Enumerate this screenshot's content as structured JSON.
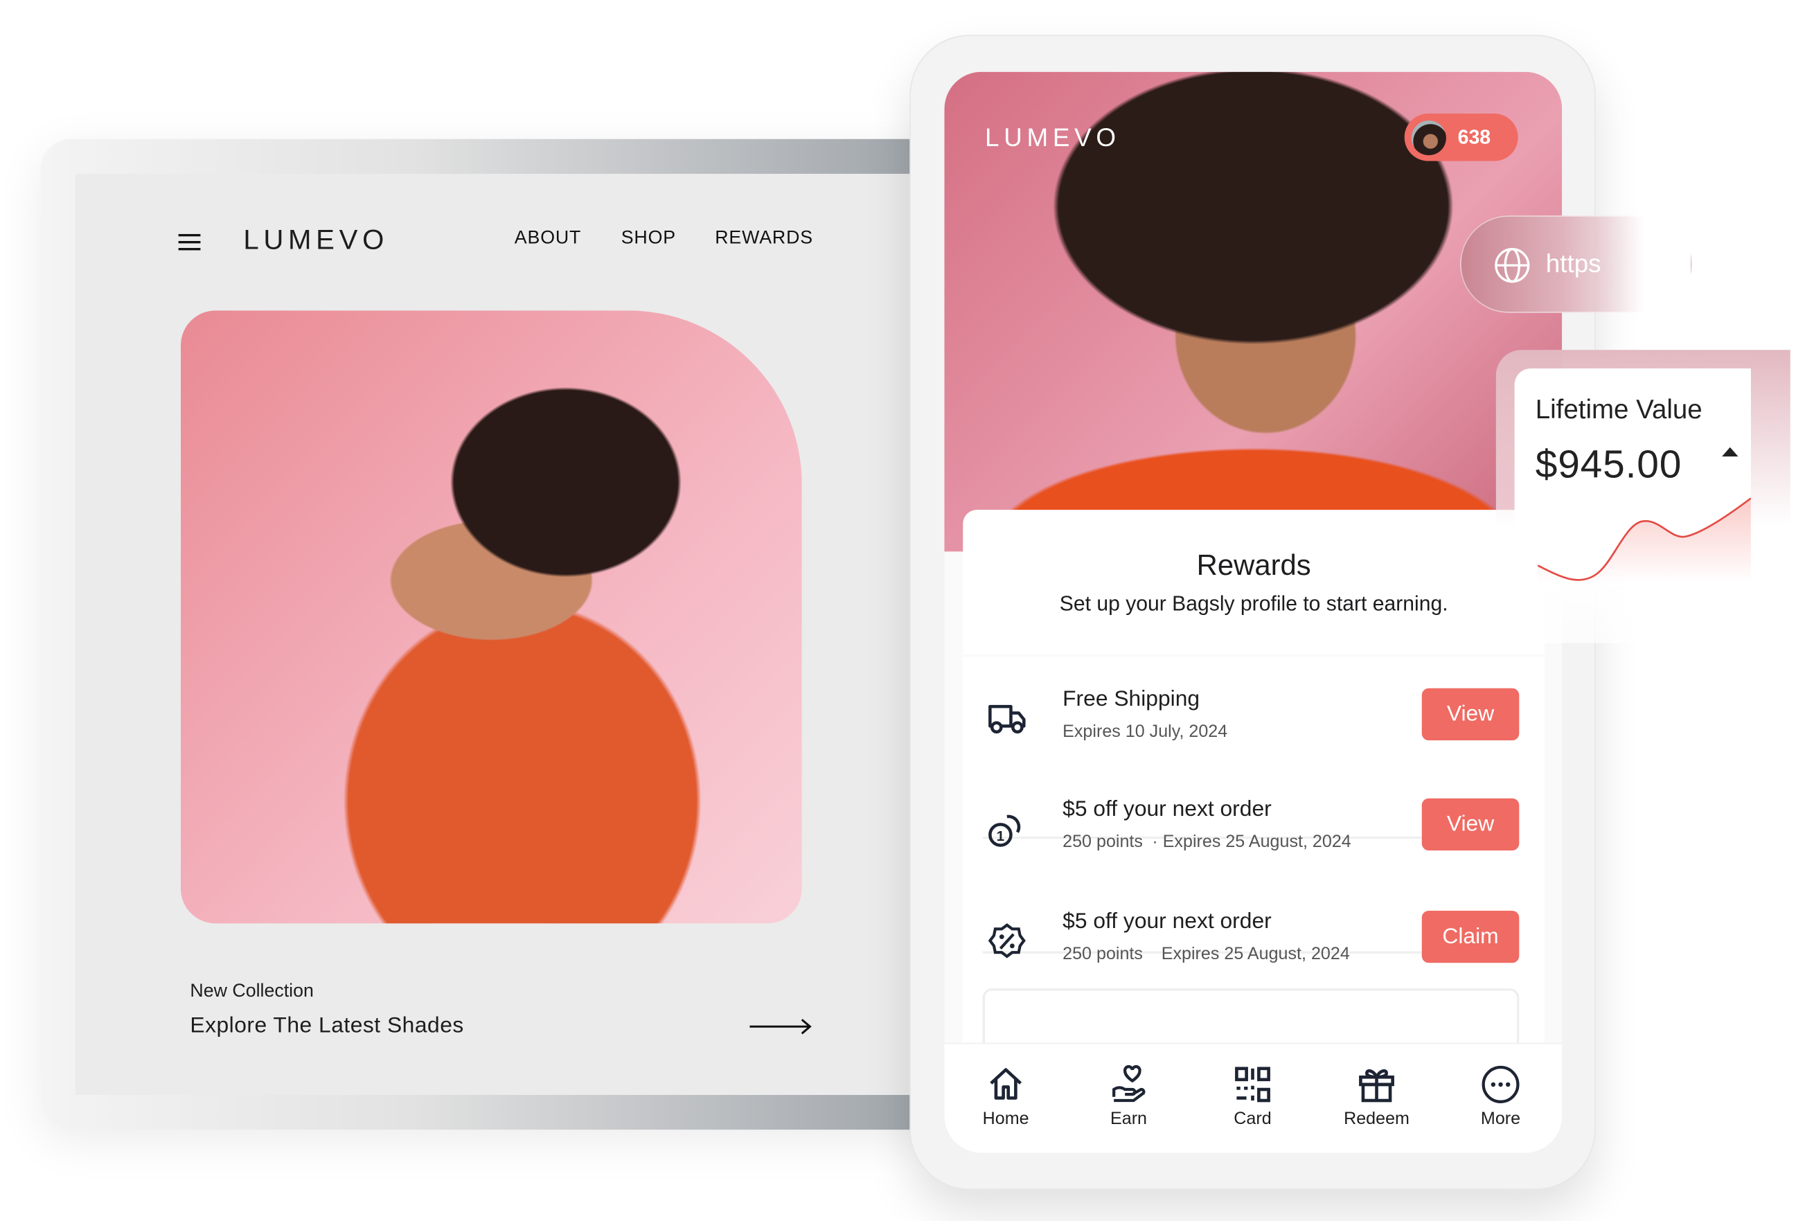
{
  "desktop": {
    "brand": "LUMEVO",
    "nav": [
      {
        "label": "ABOUT"
      },
      {
        "label": "SHOP"
      },
      {
        "label": "REWARDS"
      }
    ],
    "collection_label": "New Collection",
    "collection_title": "Explore The Latest Shades"
  },
  "mobile": {
    "brand": "LUMEVO",
    "points": "638",
    "rewards_title": "Rewards",
    "rewards_subtitle": "Set up your Bagsly profile to start earning.",
    "rewards": [
      {
        "icon": "truck-icon",
        "title": "Free Shipping",
        "points": "",
        "expires": "Expires 10 July, 2024",
        "action": "View"
      },
      {
        "icon": "coins-icon",
        "title": "$5 off your next order",
        "points": "250 points",
        "expires": "Expires 25 August, 2024",
        "action": "View"
      },
      {
        "icon": "discount-badge-icon",
        "title": "$5 off your next order",
        "points": "250 points",
        "expires": "Expires 25 August, 2024",
        "action": "Claim"
      }
    ],
    "bottom_nav": [
      {
        "label": "Home",
        "icon": "home-icon"
      },
      {
        "label": "Earn",
        "icon": "hand-heart-icon"
      },
      {
        "label": "Card",
        "icon": "qr-code-icon"
      },
      {
        "label": "Redeem",
        "icon": "gift-icon"
      },
      {
        "label": "More",
        "icon": "more-icon"
      }
    ]
  },
  "url_pill": {
    "text": "https"
  },
  "lifetime": {
    "label": "Lifetime Value",
    "value": "$945.00",
    "trend": "up"
  },
  "colors": {
    "accent": "#ef6b63",
    "text": "#1d1d1f"
  }
}
